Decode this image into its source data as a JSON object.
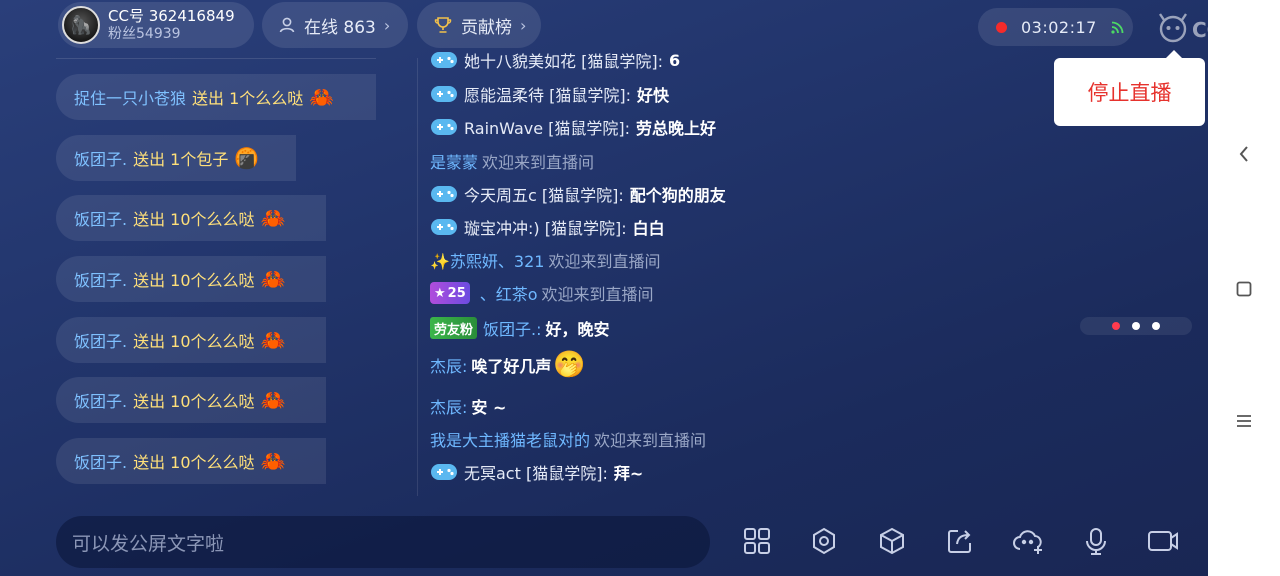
{
  "header": {
    "anchor_id": "CC号 362416849",
    "anchor_fans": "粉丝54939",
    "online_label": "在线 863",
    "contrib_label": "贡献榜",
    "timer": "03:02:17",
    "logo_text": "CC直播",
    "stop_popup": "停止直播"
  },
  "gifts": [
    {
      "user": "捉住一只小苍狼",
      "action": "送出 1个么么哒",
      "emoji": "🦀"
    },
    {
      "user": "饭团子.",
      "action": "送出 1个包子",
      "emoji": "🍘"
    },
    {
      "user": "饭团子.",
      "action": "送出 10个么么哒",
      "emoji": "🦀"
    },
    {
      "user": "饭团子.",
      "action": "送出 10个么么哒",
      "emoji": "🦀"
    },
    {
      "user": "饭团子.",
      "action": "送出 10个么么哒",
      "emoji": "🦀"
    },
    {
      "user": "饭团子.",
      "action": "送出 10个么么哒",
      "emoji": "🦀"
    },
    {
      "user": "饭团子.",
      "action": "送出 10个么么哒",
      "emoji": "🦀"
    }
  ],
  "chat": [
    {
      "kind": "game",
      "user": "她十八貌美如花 [猫鼠学院]:",
      "msg": "6"
    },
    {
      "kind": "game",
      "user": "愿能温柔待 [猫鼠学院]:",
      "msg": "好快"
    },
    {
      "kind": "game",
      "user": "RainWave [猫鼠学院]:",
      "msg": "劳总晚上好"
    },
    {
      "kind": "welcome",
      "name": "是蒙蒙",
      "text": "欢迎来到直播间"
    },
    {
      "kind": "game",
      "user": "今天周五c [猫鼠学院]:",
      "msg": "配个狗的朋友"
    },
    {
      "kind": "game",
      "user": "璇宝冲冲:) [猫鼠学院]:",
      "msg": "白白"
    },
    {
      "kind": "welcome",
      "name": "✨苏熙妍、321",
      "text": "欢迎来到直播间"
    },
    {
      "kind": "welcome_lv",
      "badge": "25",
      "name": "、红茶o",
      "text": "欢迎来到直播间"
    },
    {
      "kind": "fan",
      "badge": "劳友粉",
      "name": "饭团子.:",
      "msg": "好，晚安"
    },
    {
      "kind": "plain",
      "name": "杰辰:",
      "msg": "唉了好几声",
      "emoji": "🤭"
    },
    {
      "kind": "plain",
      "name": "杰辰:",
      "msg": "安 ~"
    },
    {
      "kind": "welcome",
      "name": "我是大主播猫老鼠对的",
      "text": "欢迎来到直播间"
    },
    {
      "kind": "game",
      "user": "无冥act [猫鼠学院]:",
      "msg": "拜~"
    }
  ],
  "input": {
    "placeholder": "可以发公屏文字啦"
  },
  "toolbar": [
    "grid-icon",
    "settings-icon",
    "cube-icon",
    "share-icon",
    "cloud-add-icon",
    "mic-icon",
    "camera-icon"
  ],
  "colors": {
    "accent_blue": "#6fb8ff",
    "gift_yellow": "#ffe07a",
    "record_red": "#f52b2b",
    "stop_red": "#e6322d"
  }
}
